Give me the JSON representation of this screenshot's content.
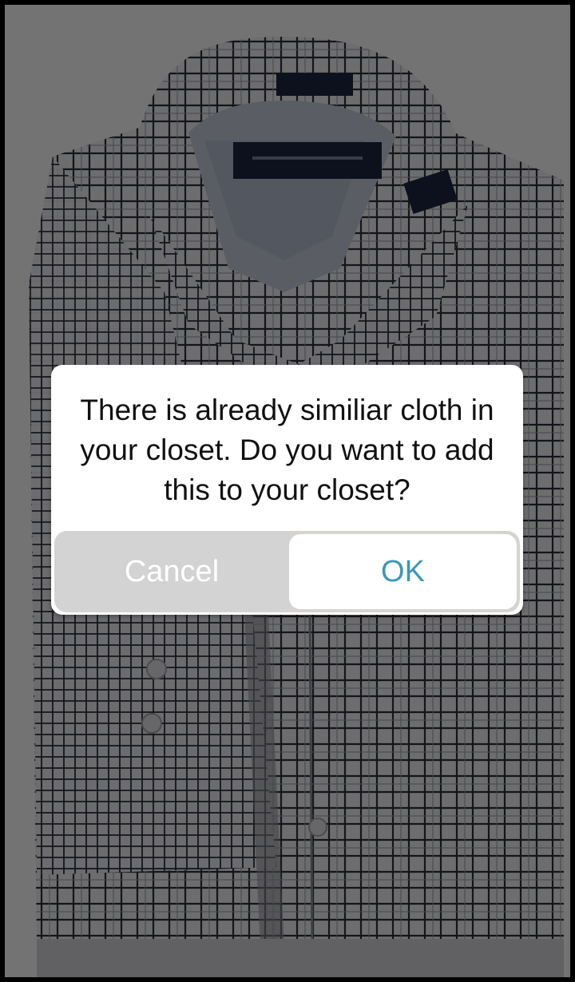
{
  "dialog": {
    "message": "There is already similiar cloth in your closet. Do you want to add this to your closet?",
    "cancel_label": "Cancel",
    "ok_label": "OK"
  },
  "colors": {
    "ok_text": "#3a98b8",
    "cancel_text": "#ffffff",
    "dialog_background": "#ffffff",
    "overlay": "#000000"
  },
  "background_image": {
    "subject": "folded checked dress shirt",
    "icon": "shirt-photo"
  }
}
